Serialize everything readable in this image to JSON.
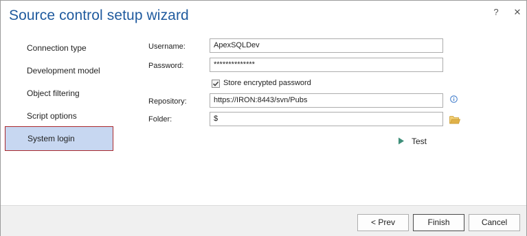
{
  "window": {
    "title": "Source control setup wizard",
    "help_glyph": "?",
    "close_glyph": "✕"
  },
  "nav": {
    "items": [
      {
        "label": "Connection type"
      },
      {
        "label": "Development model"
      },
      {
        "label": "Object filtering"
      },
      {
        "label": "Script options"
      },
      {
        "label": "System login",
        "selected": true
      }
    ]
  },
  "form": {
    "username_label": "Username:",
    "username_value": "ApexSQLDev",
    "password_label": "Password:",
    "password_value": "**************",
    "store_encrypted_label": "Store encrypted password",
    "store_encrypted_checked": true,
    "repository_label": "Repository:",
    "repository_value": "https://IRON:8443/svn/Pubs",
    "folder_label": "Folder:",
    "folder_value": "$",
    "test_label": "Test"
  },
  "icons": {
    "info": "info-icon",
    "folder": "folder-icon",
    "test": "play-icon",
    "check": "checkmark-icon"
  },
  "footer": {
    "prev_label": "< Prev",
    "finish_label": "Finish",
    "cancel_label": "Cancel"
  },
  "colors": {
    "title": "#1f5a9e",
    "nav_selected_bg": "#c7d7f1",
    "nav_selected_border": "#a9272d",
    "play_icon": "#3f8f7a",
    "info_icon": "#3a78c9",
    "folder_icon": "#e0b24a"
  }
}
